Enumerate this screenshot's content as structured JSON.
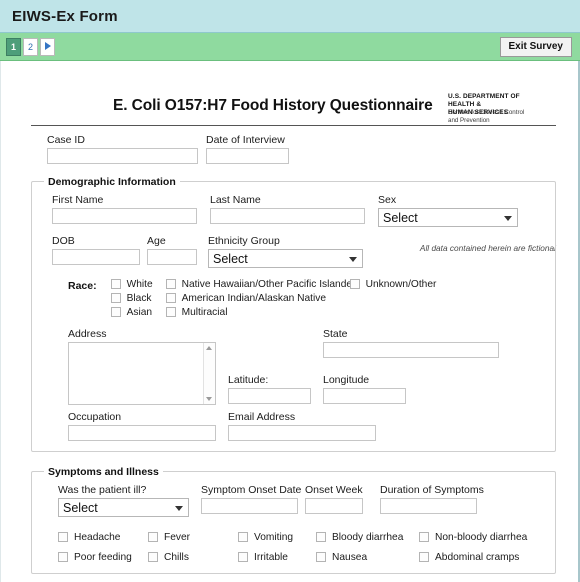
{
  "window": {
    "title": "EIWS-Ex Form"
  },
  "toolbar": {
    "pages": [
      "1",
      "2"
    ],
    "next_label": "▶",
    "exit_label": "Exit Survey"
  },
  "document": {
    "title": "E. Coli O157:H7 Food History Questionnaire",
    "agency_line1": "U.S. DEPARTMENT OF",
    "agency_line2": "HEALTH &",
    "agency_line3": "HUMAN SERVICES",
    "agency_sub1": "Centers for Disease Control",
    "agency_sub2": "and Prevention",
    "disclaimer": "All data contained herein are fictional"
  },
  "top_fields": [
    {
      "label": "Case ID",
      "value": "",
      "placeholder": ""
    },
    {
      "label": "Date of Interview",
      "value": "",
      "placeholder": ""
    }
  ],
  "demographic": {
    "legend": "Demographic Information",
    "first_name": {
      "label": "First Name",
      "value": ""
    },
    "last_name": {
      "label": "Last Name",
      "value": ""
    },
    "sex": {
      "label": "Sex",
      "value": "Select"
    },
    "dob": {
      "label": "DOB",
      "value": ""
    },
    "age": {
      "label": "Age",
      "value": ""
    },
    "ethnicity": {
      "label": "Ethnicity Group",
      "value": "Select"
    },
    "race": {
      "label": "Race:",
      "col1": [
        "White",
        "Black",
        "Asian"
      ],
      "col2": [
        "Native Hawaiian/Other Pacific Islander",
        "American Indian/Alaskan Native",
        "Multiracial"
      ],
      "col3": [
        "Unknown/Other"
      ]
    },
    "address": {
      "label": "Address",
      "value": ""
    },
    "state": {
      "label": "State",
      "value": ""
    },
    "latitude": {
      "label": "Latitude:",
      "value": ""
    },
    "longitude": {
      "label": "Longitude",
      "value": ""
    },
    "occupation": {
      "label": "Occupation",
      "value": ""
    },
    "email": {
      "label": "Email Address",
      "value": ""
    }
  },
  "symptoms": {
    "legend": "Symptoms and Illness",
    "was_ill": {
      "label": "Was the patient ill?",
      "value": "Select"
    },
    "onset_date": {
      "label": "Symptom Onset Date",
      "value": ""
    },
    "onset_week": {
      "label": "Onset Week",
      "value": ""
    },
    "duration": {
      "label": "Duration of Symptoms",
      "value": ""
    },
    "row1": [
      "Headache",
      "Fever",
      "Vomiting",
      "Bloody diarrhea",
      "Non-bloody diarrhea"
    ],
    "row2": [
      "Poor feeding",
      "Chills",
      "Irritable",
      "Nausea",
      "Abdominal cramps"
    ]
  },
  "colors": {
    "title_bar": "#bfe4e8",
    "toolbar": "#8fda9f",
    "active_page": "#4e9e7a",
    "link": "#3575c4"
  }
}
